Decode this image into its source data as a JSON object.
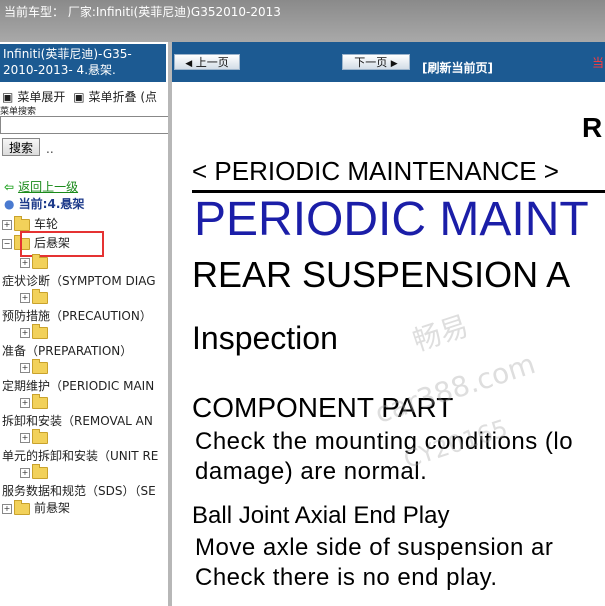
{
  "topbar": {
    "text": "当前车型：  厂家:Infiniti(英菲尼迪)G352010-2013"
  },
  "sidebar": {
    "title": "Infiniti(英菲尼迪)-G35-2010-2013- 4.悬架.",
    "expand_label": "菜单展开",
    "collapse_label": "菜单折叠 (点",
    "search_label": "菜单搜索",
    "search_value": "",
    "search_button": "搜索",
    "search_dots": "..",
    "back_link": "返回上一级",
    "current": "当前:4.悬架",
    "tree": [
      {
        "label": "车轮"
      },
      {
        "label": "后悬架"
      },
      {
        "label": ""
      },
      {
        "label": "症状诊断（SYMPTOM DIAG"
      },
      {
        "label": ""
      },
      {
        "label": "预防措施（PRECAUTION）"
      },
      {
        "label": ""
      },
      {
        "label": "准备（PREPARATION）"
      },
      {
        "label": ""
      },
      {
        "label": "定期维护（PERIODIC MAIN"
      },
      {
        "label": ""
      },
      {
        "label": "拆卸和安装（REMOVAL AN"
      },
      {
        "label": ""
      },
      {
        "label": "单元的拆卸和安装（UNIT RE"
      },
      {
        "label": ""
      },
      {
        "label": "服务数据和规范（SDS）（SE"
      },
      {
        "label": "前悬架"
      }
    ]
  },
  "navbar": {
    "prev_label": "上一页",
    "next_label": "下一页",
    "refresh_label": "[刷新当前页]",
    "cut_text": "当"
  },
  "document": {
    "corner": "R",
    "periodic_small": "< PERIODIC MAINTENANCE >",
    "periodic_big": "PERIODIC MAINT",
    "rear": "REAR SUSPENSION A",
    "inspection": "Inspection",
    "component": "COMPONENT PART",
    "component_line1": "Check the mounting conditions (lo",
    "component_line2": "damage) are normal.",
    "balljoint": "Ball Joint Axial End Play",
    "balljoint_line1": "Move axle side of suspension ar",
    "balljoint_line2": "Check there is no end play."
  },
  "watermark": {
    "line1": "畅易",
    "line2": "car388.com",
    "line3": "CY20165"
  },
  "colors": {
    "accent": "#1c5a92",
    "heading_blue": "#1b1ea8",
    "highlight_red": "#e53232"
  }
}
